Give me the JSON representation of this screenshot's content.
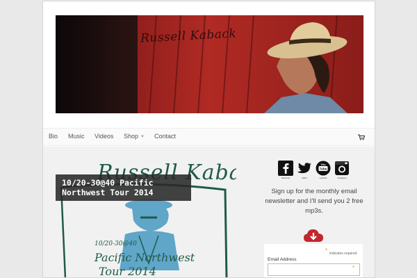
{
  "header": {
    "signature": "Russell Kaback"
  },
  "nav": {
    "items": [
      {
        "label": "Bio"
      },
      {
        "label": "Music"
      },
      {
        "label": "Videos"
      },
      {
        "label": "Shop"
      },
      {
        "label": "Contact"
      }
    ],
    "cart_icon": "shopping-cart-icon"
  },
  "post": {
    "title": "10/20-30@40 Pacific Northwest Tour 2014",
    "poster_heading": "Russell Kaback",
    "poster_date": "10/20-30@40",
    "poster_subtitle": "Pacific Northwest",
    "poster_year": "Tour 2014"
  },
  "sidebar": {
    "social": [
      {
        "icon": "facebook-icon",
        "label": "facebook"
      },
      {
        "icon": "twitter-icon",
        "label": "twitter"
      },
      {
        "icon": "youtube-icon",
        "label": "youtube"
      },
      {
        "icon": "instagram-icon",
        "label": "instagram"
      }
    ],
    "signup_text": "Sign up for the monthly email newsletter and I'll send you 2 free mp3s.",
    "download_icon": "cloud-download-icon",
    "form": {
      "required_star": "*",
      "required_text": "indicates required",
      "email_label": "Email Address",
      "email_star": "*",
      "email_value": ""
    }
  },
  "colors": {
    "accent_red": "#c0282c",
    "poster_green": "#1f5a4a",
    "poster_blue": "#5fa6c8",
    "required_gold": "#c8a000"
  }
}
